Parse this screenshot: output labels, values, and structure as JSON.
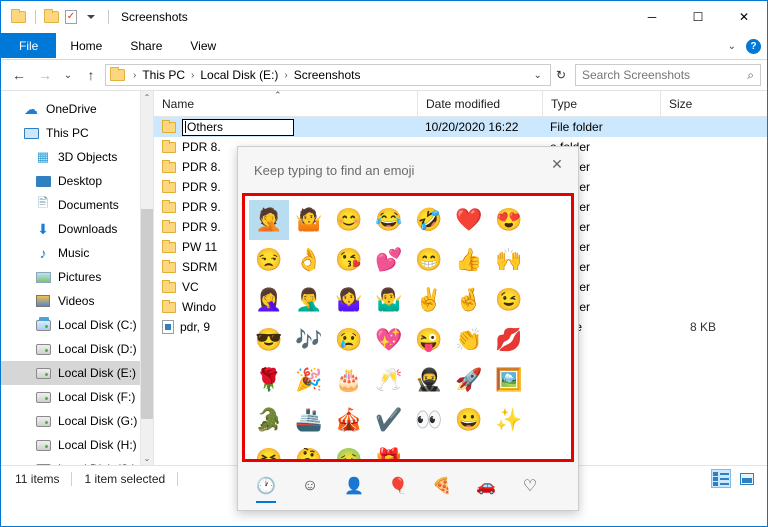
{
  "window": {
    "title": "Screenshots",
    "minimize": "─",
    "maximize": "☐",
    "close": "✕"
  },
  "ribbon": {
    "tabs": [
      "File",
      "Home",
      "Share",
      "View"
    ],
    "help_label": "?",
    "collapse_label": "⌄"
  },
  "address": {
    "back": "←",
    "forward": "→",
    "recent": "⌄",
    "up": "↑",
    "crumbs": [
      "This PC",
      "Local Disk (E:)",
      "Screenshots"
    ],
    "separator": "›",
    "dropdown": "⌄",
    "refresh": "↻",
    "search_placeholder": "Search Screenshots",
    "search_value": "",
    "search_icon": "⌕"
  },
  "sidebar": {
    "items": [
      {
        "label": "OneDrive",
        "icon": "cloud-icon",
        "indent": false,
        "selected": false
      },
      {
        "label": "This PC",
        "icon": "monitor-icon",
        "indent": false,
        "selected": false
      },
      {
        "label": "3D Objects",
        "icon": "cube-icon",
        "indent": true,
        "selected": false
      },
      {
        "label": "Desktop",
        "icon": "desktop-icon",
        "indent": true,
        "selected": false
      },
      {
        "label": "Documents",
        "icon": "documents-icon",
        "indent": true,
        "selected": false
      },
      {
        "label": "Downloads",
        "icon": "download-icon",
        "indent": true,
        "selected": false
      },
      {
        "label": "Music",
        "icon": "music-icon",
        "indent": true,
        "selected": false
      },
      {
        "label": "Pictures",
        "icon": "pictures-icon",
        "indent": true,
        "selected": false
      },
      {
        "label": "Videos",
        "icon": "videos-icon",
        "indent": true,
        "selected": false
      },
      {
        "label": "Local Disk (C:)",
        "icon": "system-drive-icon",
        "indent": true,
        "selected": false
      },
      {
        "label": "Local Disk (D:)",
        "icon": "drive-icon",
        "indent": true,
        "selected": false
      },
      {
        "label": "Local Disk (E:)",
        "icon": "drive-icon",
        "indent": true,
        "selected": true
      },
      {
        "label": "Local Disk (F:)",
        "icon": "drive-icon",
        "indent": true,
        "selected": false
      },
      {
        "label": "Local Disk (G:)",
        "icon": "drive-icon",
        "indent": true,
        "selected": false
      },
      {
        "label": "Local Disk (H:)",
        "icon": "drive-icon",
        "indent": true,
        "selected": false
      },
      {
        "label": "Local Disk (S:)",
        "icon": "drive-icon",
        "indent": true,
        "selected": false
      }
    ],
    "scroll_up": "⌃",
    "scroll_down": "⌄"
  },
  "filelist": {
    "columns": [
      "Name",
      "Date modified",
      "Type",
      "Size"
    ],
    "sort_indicator": "⌃",
    "rows": [
      {
        "name": "Others",
        "date": "10/20/2020 16:22",
        "type": "File folder",
        "size": "",
        "kind": "folder",
        "selected": true,
        "renaming": true
      },
      {
        "name": "PDR 8.",
        "date": "",
        "type": "e folder",
        "size": "",
        "kind": "folder",
        "selected": false,
        "renaming": false
      },
      {
        "name": "PDR 8.",
        "date": "",
        "type": "e folder",
        "size": "",
        "kind": "folder",
        "selected": false,
        "renaming": false
      },
      {
        "name": "PDR 9.",
        "date": "",
        "type": "e folder",
        "size": "",
        "kind": "folder",
        "selected": false,
        "renaming": false
      },
      {
        "name": "PDR 9.",
        "date": "",
        "type": "e folder",
        "size": "",
        "kind": "folder",
        "selected": false,
        "renaming": false
      },
      {
        "name": "PDR 9.",
        "date": "",
        "type": "e folder",
        "size": "",
        "kind": "folder",
        "selected": false,
        "renaming": false
      },
      {
        "name": "PW 11",
        "date": "",
        "type": "e folder",
        "size": "",
        "kind": "folder",
        "selected": false,
        "renaming": false
      },
      {
        "name": "SDRM",
        "date": "",
        "type": "e folder",
        "size": "",
        "kind": "folder",
        "selected": false,
        "renaming": false
      },
      {
        "name": "VC",
        "date": "",
        "type": "e folder",
        "size": "",
        "kind": "folder",
        "selected": false,
        "renaming": false
      },
      {
        "name": "Windo",
        "date": "",
        "type": "e folder",
        "size": "",
        "kind": "folder",
        "selected": false,
        "renaming": false
      },
      {
        "name": "pdr, 9",
        "date": "",
        "type": "G File",
        "size": "8 KB",
        "kind": "file",
        "selected": false,
        "renaming": false
      }
    ]
  },
  "emoji_panel": {
    "hint": "Keep typing to find an emoji",
    "close_label": "✕",
    "border_color": "#e60000",
    "accent_color": "#0078d7",
    "selected_index": 0,
    "emojis": [
      {
        "glyph": "🤦",
        "name": "person-facepalming"
      },
      {
        "glyph": "🤷",
        "name": "person-shrugging"
      },
      {
        "glyph": "😊",
        "name": "smiling-face-smiling-eyes"
      },
      {
        "glyph": "😂",
        "name": "face-with-tears-of-joy"
      },
      {
        "glyph": "🤣",
        "name": "rolling-on-the-floor-laughing"
      },
      {
        "glyph": "❤️",
        "name": "red-heart"
      },
      {
        "glyph": "😍",
        "name": "smiling-face-heart-eyes"
      },
      {
        "glyph": "😒",
        "name": "unamused-face"
      },
      {
        "glyph": "👌",
        "name": "ok-hand"
      },
      {
        "glyph": "😘",
        "name": "face-blowing-a-kiss"
      },
      {
        "glyph": "💕",
        "name": "two-hearts"
      },
      {
        "glyph": "😁",
        "name": "beaming-face-smiling-eyes"
      },
      {
        "glyph": "👍",
        "name": "thumbs-up"
      },
      {
        "glyph": "🙌",
        "name": "raising-hands"
      },
      {
        "glyph": "🤦‍♀️",
        "name": "woman-facepalming"
      },
      {
        "glyph": "🤦‍♂️",
        "name": "man-facepalming"
      },
      {
        "glyph": "🤷‍♀️",
        "name": "woman-shrugging"
      },
      {
        "glyph": "🤷‍♂️",
        "name": "man-shrugging"
      },
      {
        "glyph": "✌️",
        "name": "victory-hand"
      },
      {
        "glyph": "🤞",
        "name": "crossed-fingers"
      },
      {
        "glyph": "😉",
        "name": "winking-face"
      },
      {
        "glyph": "😎",
        "name": "smiling-face-with-sunglasses"
      },
      {
        "glyph": "🎶",
        "name": "musical-notes"
      },
      {
        "glyph": "😢",
        "name": "crying-face"
      },
      {
        "glyph": "💖",
        "name": "sparkling-heart"
      },
      {
        "glyph": "😜",
        "name": "winking-face-with-tongue"
      },
      {
        "glyph": "👏",
        "name": "clapping-hands"
      },
      {
        "glyph": "💋",
        "name": "kiss-mark"
      },
      {
        "glyph": "🌹",
        "name": "rose"
      },
      {
        "glyph": "🎉",
        "name": "party-popper"
      },
      {
        "glyph": "🎂",
        "name": "birthday-cake"
      },
      {
        "glyph": "🥂",
        "name": "clinking-glasses"
      },
      {
        "glyph": "🥷",
        "name": "ninja"
      },
      {
        "glyph": "🚀",
        "name": "rocket"
      },
      {
        "glyph": "🖼️",
        "name": "framed-picture"
      },
      {
        "glyph": "🐊",
        "name": "crocodile"
      },
      {
        "glyph": "🚢",
        "name": "ship"
      },
      {
        "glyph": "🎪",
        "name": "circus-tent"
      },
      {
        "glyph": "✔️",
        "name": "check-mark"
      },
      {
        "glyph": "👀",
        "name": "eyes"
      },
      {
        "glyph": "😀",
        "name": "grinning-face"
      },
      {
        "glyph": "✨",
        "name": "sparkles"
      },
      {
        "glyph": "😆",
        "name": "grinning-squinting-face"
      },
      {
        "glyph": "🤔",
        "name": "thinking-face"
      },
      {
        "glyph": "🤢",
        "name": "nauseated-face"
      },
      {
        "glyph": "🎁",
        "name": "wrapped-gift"
      }
    ],
    "tabs": [
      {
        "glyph": "🕐",
        "name": "recent-tab",
        "active": true
      },
      {
        "glyph": "☺",
        "name": "smileys-tab",
        "active": false
      },
      {
        "glyph": "👤",
        "name": "people-tab",
        "active": false
      },
      {
        "glyph": "🎈",
        "name": "celebration-tab",
        "active": false
      },
      {
        "glyph": "🍕",
        "name": "food-tab",
        "active": false
      },
      {
        "glyph": "🚗",
        "name": "transport-tab",
        "active": false
      },
      {
        "glyph": "♡",
        "name": "symbols-tab",
        "active": false
      }
    ]
  },
  "statusbar": {
    "item_count": "11 items",
    "selection": "1 item selected",
    "details_view": "details-view",
    "thumbnail_view": "large-icons-view"
  }
}
